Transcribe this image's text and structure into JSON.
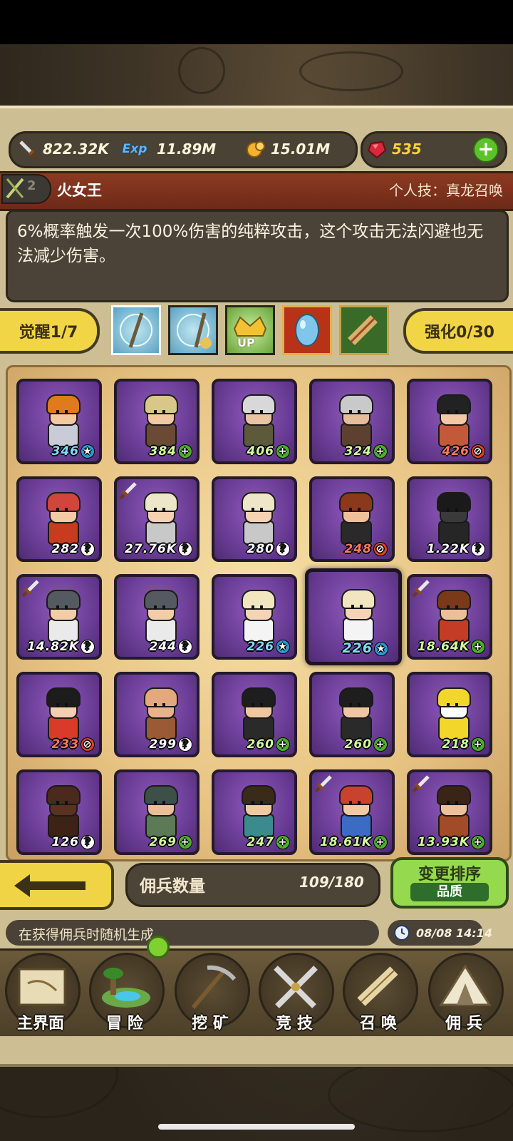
{
  "resources": {
    "attack": "822.32K",
    "exp_icon_text": "Exp",
    "exp": "11.89M",
    "gold": "15.01M",
    "gems": "535"
  },
  "hero": {
    "level_badge": "2",
    "name": "火女王",
    "skill": "个人技：真龙召唤",
    "description": "6%概率触发一次100%伤害的纯粹攻击，这个攻击无法闪避也无法减少伤害。"
  },
  "actions": {
    "awaken": "觉醒1/7",
    "enhance": "强化0/30",
    "up_icon_text": "UP"
  },
  "mercenaries": [
    {
      "level": "346",
      "mark": "★",
      "kind": "s",
      "tag": false,
      "hair": "#e07a1c",
      "skin": "#f4c9a0",
      "body": "#c9ccd6"
    },
    {
      "level": "384",
      "mark": "+",
      "kind": "p",
      "tag": false,
      "hair": "#d9c78a",
      "skin": "#f1c8a0",
      "body": "#6b4a35"
    },
    {
      "level": "406",
      "mark": "+",
      "kind": "p",
      "tag": false,
      "hair": "#d8d8d8",
      "skin": "#eac4a0",
      "body": "#5d5a3c"
    },
    {
      "level": "324",
      "mark": "+",
      "kind": "p",
      "tag": false,
      "hair": "#c9c9c9",
      "skin": "#e6bd98",
      "body": "#5e4030"
    },
    {
      "level": "426",
      "mark": "⊘",
      "kind": "r",
      "tag": false,
      "hair": "#222222",
      "skin": "#f2c8a5",
      "body": "#c25a3a"
    },
    {
      "level": "282",
      "mark": "?",
      "kind": "q",
      "tag": false,
      "hair": "#d2453a",
      "skin": "#f4c9a5",
      "body": "#c73c1e"
    },
    {
      "level": "27.76K",
      "mark": "?",
      "kind": "q",
      "tag": true,
      "hair": "#eee6c8",
      "skin": "#f4d2b2",
      "body": "#c8c8c8"
    },
    {
      "level": "280",
      "mark": "?",
      "kind": "q",
      "tag": false,
      "hair": "#eee6c8",
      "skin": "#f4d2b2",
      "body": "#c8c8c8"
    },
    {
      "level": "248",
      "mark": "⊘",
      "kind": "r",
      "tag": false,
      "hair": "#8a3a1a",
      "skin": "#f0c09a",
      "body": "#2a2a2a"
    },
    {
      "level": "1.22K",
      "mark": "?",
      "kind": "q",
      "tag": false,
      "hair": "#1a1a1a",
      "skin": "#3a3a3a",
      "body": "#262626"
    },
    {
      "level": "14.82K",
      "mark": "?",
      "kind": "q",
      "tag": true,
      "hair": "#555a60",
      "skin": "#f3cca8",
      "body": "#eaeaea"
    },
    {
      "level": "244",
      "mark": "?",
      "kind": "q",
      "tag": false,
      "hair": "#555a60",
      "skin": "#f3cca8",
      "body": "#eaeaea"
    },
    {
      "level": "226",
      "mark": "★",
      "kind": "s",
      "tag": false,
      "hair": "#f1e6c0",
      "skin": "#f5d3b5",
      "body": "#f4f4f4"
    },
    {
      "level": "226",
      "mark": "★",
      "kind": "s",
      "tag": false,
      "hair": "#f1e6c0",
      "skin": "#f5d3b5",
      "body": "#f4f4f4",
      "big": true
    },
    {
      "level": "18.64K",
      "mark": "+",
      "kind": "p",
      "tag": true,
      "hair": "#7a3a1a",
      "skin": "#f0be95",
      "body": "#c43c24"
    },
    {
      "level": "233",
      "mark": "⊘",
      "kind": "r",
      "tag": false,
      "hair": "#1c1c1c",
      "skin": "#f4cfb0",
      "body": "#d93a2a"
    },
    {
      "level": "299",
      "mark": "?",
      "kind": "q",
      "tag": false,
      "hair": "#e3a880",
      "skin": "#e8b38c",
      "body": "#9a5a35"
    },
    {
      "level": "260",
      "mark": "+",
      "kind": "p",
      "tag": false,
      "hair": "#1e1e1e",
      "skin": "#f0c6a0",
      "body": "#2a2a2a"
    },
    {
      "level": "260",
      "mark": "+",
      "kind": "p",
      "tag": false,
      "hair": "#1e1e1e",
      "skin": "#f0c6a0",
      "body": "#2a2a2a"
    },
    {
      "level": "218",
      "mark": "+",
      "kind": "p",
      "tag": false,
      "hair": "#f2d62a",
      "skin": "#ffffff",
      "body": "#f2d62a"
    },
    {
      "level": "126",
      "mark": "?",
      "kind": "q",
      "tag": false,
      "hair": "#4a2a1c",
      "skin": "#5a3222",
      "body": "#3d2216"
    },
    {
      "level": "269",
      "mark": "+",
      "kind": "p",
      "tag": false,
      "hair": "#3c5048",
      "skin": "#e9bf98",
      "body": "#5b7a55"
    },
    {
      "level": "247",
      "mark": "+",
      "kind": "p",
      "tag": false,
      "hair": "#3a2a1a",
      "skin": "#f0c8a2",
      "body": "#3b8a8e"
    },
    {
      "level": "18.61K",
      "mark": "+",
      "kind": "p",
      "tag": true,
      "hair": "#c9432c",
      "skin": "#f3c8a4",
      "body": "#3b6bc2"
    },
    {
      "level": "13.93K",
      "mark": "+",
      "kind": "p",
      "tag": true,
      "hair": "#3a2418",
      "skin": "#eec09a",
      "body": "#a14b28"
    }
  ],
  "footer": {
    "count_label": "佣兵数量",
    "count_value": "109/180",
    "sort_label": "变更排序",
    "sort_sub": "品质",
    "tip": "在获得佣兵时随机生成",
    "time": "08/08 14:14"
  },
  "nav": [
    "主界面",
    "冒 险",
    "挖 矿",
    "竞 技",
    "召 唤",
    "佣 兵"
  ],
  "colors": {
    "gem": "#ffd23a",
    "card": "#6a3d95",
    "accent": "#f2d547"
  }
}
